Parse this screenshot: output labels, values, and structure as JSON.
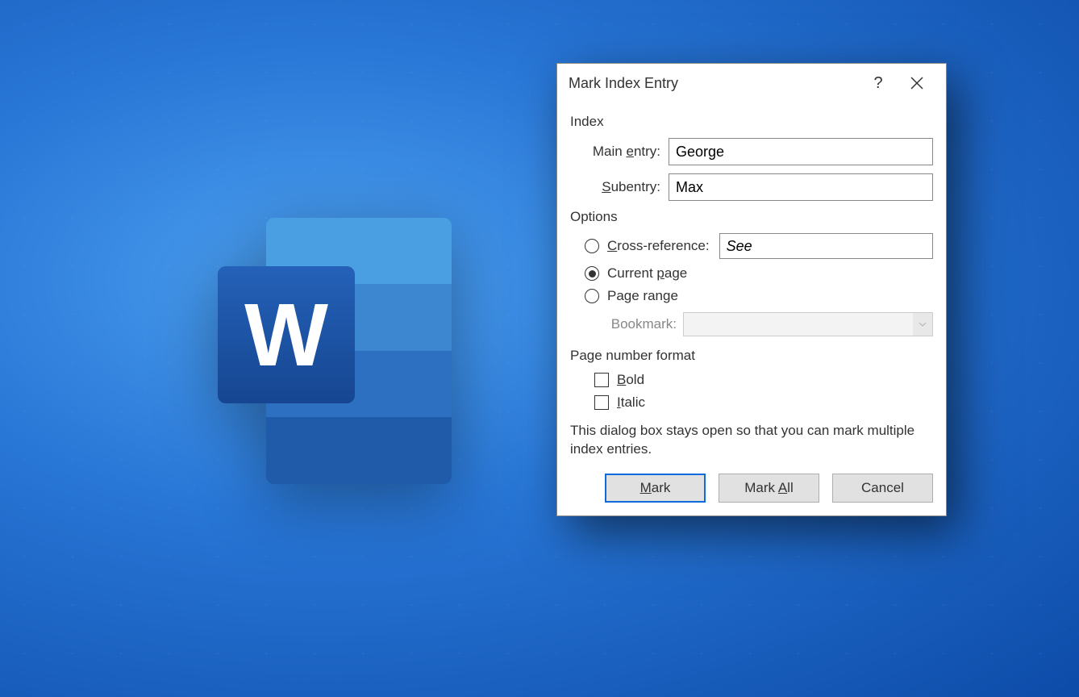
{
  "dialog": {
    "title": "Mark Index Entry",
    "sections": {
      "index": "Index",
      "options": "Options",
      "page_format": "Page number format"
    },
    "fields": {
      "main_entry_label_pre": "Main ",
      "main_entry_label_accel": "e",
      "main_entry_label_post": "ntry:",
      "main_entry_value": "George",
      "subentry_label_accel": "S",
      "subentry_label_post": "ubentry:",
      "subentry_value": "Max"
    },
    "options_group": {
      "crossref_label_accel": "C",
      "crossref_label_post": "ross-reference:",
      "crossref_value": "See",
      "current_page_pre": "Current ",
      "current_page_accel": "p",
      "current_page_post": "age",
      "page_range": "Page range",
      "bookmark_label": "Bookmark:",
      "selected": "current_page"
    },
    "format": {
      "bold_accel": "B",
      "bold_post": "old",
      "italic_accel": "I",
      "italic_post": "talic",
      "bold_checked": false,
      "italic_checked": false
    },
    "note": "This dialog box stays open so that you can mark multiple index entries.",
    "buttons": {
      "mark_accel": "M",
      "mark_post": "ark",
      "mark_all_pre": "Mark ",
      "mark_all_accel": "A",
      "mark_all_post": "ll",
      "cancel": "Cancel"
    }
  }
}
